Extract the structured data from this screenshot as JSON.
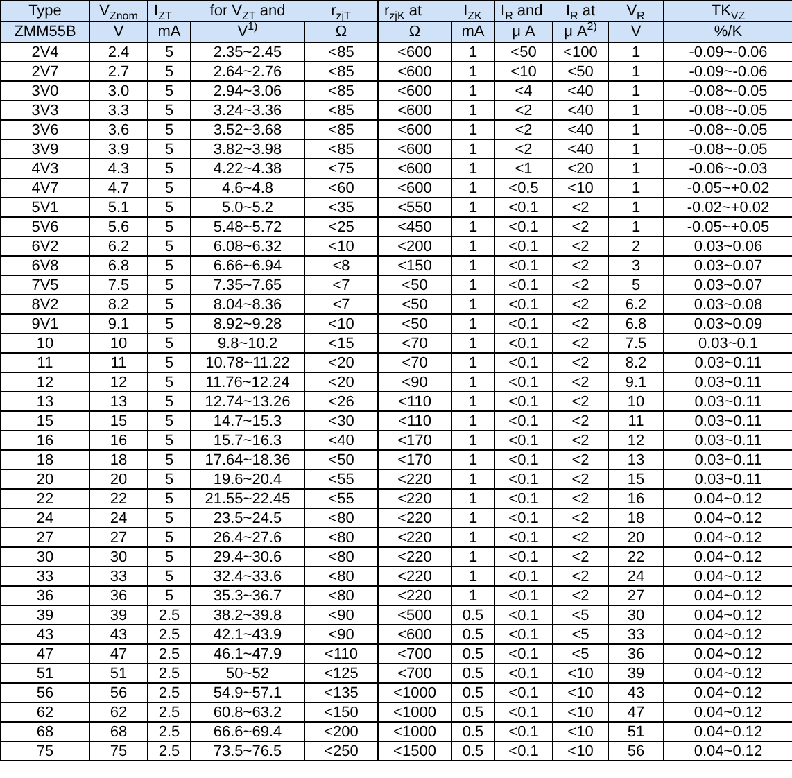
{
  "table": {
    "header_groups": [
      {
        "cells": [
          "Type"
        ]
      },
      {
        "cells": [
          "V$_{Znom}$"
        ]
      },
      {
        "cells": [
          "I$_{ZT}$",
          "for V$_{ZT}$ and",
          "r$_{zjT}$"
        ]
      },
      {
        "cells": [
          "r$_{zjK}$  at",
          "I$_{ZK}$"
        ]
      },
      {
        "cells": [
          "I$_{R}$   and",
          "I$_{R}$   at",
          "V$_{R}$"
        ]
      },
      {
        "cells": [
          "TK$_{VZ}$"
        ]
      }
    ],
    "units": [
      "ZMM55B",
      "V",
      "mA",
      "V$^{1)}$",
      "Ω",
      "Ω",
      "mA",
      "μ A",
      "μ A$^{2)}$",
      "V",
      "%/K"
    ],
    "rows": [
      [
        "2V4",
        "2.4",
        "5",
        "2.35~2.45",
        "<85",
        "<600",
        "1",
        "<50",
        "<100",
        "1",
        "-0.09~-0.06"
      ],
      [
        "2V7",
        "2.7",
        "5",
        "2.64~2.76",
        "<85",
        "<600",
        "1",
        "<10",
        "<50",
        "1",
        "-0.09~-0.06"
      ],
      [
        "3V0",
        "3.0",
        "5",
        "2.94~3.06",
        "<85",
        "<600",
        "1",
        "<4",
        "<40",
        "1",
        "-0.08~-0.05"
      ],
      [
        "3V3",
        "3.3",
        "5",
        "3.24~3.36",
        "<85",
        "<600",
        "1",
        "<2",
        "<40",
        "1",
        "-0.08~-0.05"
      ],
      [
        "3V6",
        "3.6",
        "5",
        "3.52~3.68",
        "<85",
        "<600",
        "1",
        "<2",
        "<40",
        "1",
        "-0.08~-0.05"
      ],
      [
        "3V9",
        "3.9",
        "5",
        "3.82~3.98",
        "<85",
        "<600",
        "1",
        "<2",
        "<40",
        "1",
        "-0.08~-0.05"
      ],
      [
        "4V3",
        "4.3",
        "5",
        "4.22~4.38",
        "<75",
        "<600",
        "1",
        "<1",
        "<20",
        "1",
        "-0.06~-0.03"
      ],
      [
        "4V7",
        "4.7",
        "5",
        "4.6~4.8",
        "<60",
        "<600",
        "1",
        "<0.5",
        "<10",
        "1",
        "-0.05~+0.02"
      ],
      [
        "5V1",
        "5.1",
        "5",
        "5.0~5.2",
        "<35",
        "<550",
        "1",
        "<0.1",
        "<2",
        "1",
        "-0.02~+0.02"
      ],
      [
        "5V6",
        "5.6",
        "5",
        "5.48~5.72",
        "<25",
        "<450",
        "1",
        "<0.1",
        "<2",
        "1",
        "-0.05~+0.05"
      ],
      [
        "6V2",
        "6.2",
        "5",
        "6.08~6.32",
        "<10",
        "<200",
        "1",
        "<0.1",
        "<2",
        "2",
        "0.03~0.06"
      ],
      [
        "6V8",
        "6.8",
        "5",
        "6.66~6.94",
        "<8",
        "<150",
        "1",
        "<0.1",
        "<2",
        "3",
        "0.03~0.07"
      ],
      [
        "7V5",
        "7.5",
        "5",
        "7.35~7.65",
        "<7",
        "<50",
        "1",
        "<0.1",
        "<2",
        "5",
        "0.03~0.07"
      ],
      [
        "8V2",
        "8.2",
        "5",
        "8.04~8.36",
        "<7",
        "<50",
        "1",
        "<0.1",
        "<2",
        "6.2",
        "0.03~0.08"
      ],
      [
        "9V1",
        "9.1",
        "5",
        "8.92~9.28",
        "<10",
        "<50",
        "1",
        "<0.1",
        "<2",
        "6.8",
        "0.03~0.09"
      ],
      [
        "10",
        "10",
        "5",
        "9.8~10.2",
        "<15",
        "<70",
        "1",
        "<0.1",
        "<2",
        "7.5",
        "0.03~0.1"
      ],
      [
        "11",
        "11",
        "5",
        "10.78~11.22",
        "<20",
        "<70",
        "1",
        "<0.1",
        "<2",
        "8.2",
        "0.03~0.11"
      ],
      [
        "12",
        "12",
        "5",
        "11.76~12.24",
        "<20",
        "<90",
        "1",
        "<0.1",
        "<2",
        "9.1",
        "0.03~0.11"
      ],
      [
        "13",
        "13",
        "5",
        "12.74~13.26",
        "<26",
        "<110",
        "1",
        "<0.1",
        "<2",
        "10",
        "0.03~0.11"
      ],
      [
        "15",
        "15",
        "5",
        "14.7~15.3",
        "<30",
        "<110",
        "1",
        "<0.1",
        "<2",
        "11",
        "0.03~0.11"
      ],
      [
        "16",
        "16",
        "5",
        "15.7~16.3",
        "<40",
        "<170",
        "1",
        "<0.1",
        "<2",
        "12",
        "0.03~0.11"
      ],
      [
        "18",
        "18",
        "5",
        "17.64~18.36",
        "<50",
        "<170",
        "1",
        "<0.1",
        "<2",
        "13",
        "0.03~0.11"
      ],
      [
        "20",
        "20",
        "5",
        "19.6~20.4",
        "<55",
        "<220",
        "1",
        "<0.1",
        "<2",
        "15",
        "0.03~0.11"
      ],
      [
        "22",
        "22",
        "5",
        "21.55~22.45",
        "<55",
        "<220",
        "1",
        "<0.1",
        "<2",
        "16",
        "0.04~0.12"
      ],
      [
        "24",
        "24",
        "5",
        "23.5~24.5",
        "<80",
        "<220",
        "1",
        "<0.1",
        "<2",
        "18",
        "0.04~0.12"
      ],
      [
        "27",
        "27",
        "5",
        "26.4~27.6",
        "<80",
        "<220",
        "1",
        "<0.1",
        "<2",
        "20",
        "0.04~0.12"
      ],
      [
        "30",
        "30",
        "5",
        "29.4~30.6",
        "<80",
        "<220",
        "1",
        "<0.1",
        "<2",
        "22",
        "0.04~0.12"
      ],
      [
        "33",
        "33",
        "5",
        "32.4~33.6",
        "<80",
        "<220",
        "1",
        "<0.1",
        "<2",
        "24",
        "0.04~0.12"
      ],
      [
        "36",
        "36",
        "5",
        "35.3~36.7",
        "<80",
        "<220",
        "1",
        "<0.1",
        "<2",
        "27",
        "0.04~0.12"
      ],
      [
        "39",
        "39",
        "2.5",
        "38.2~39.8",
        "<90",
        "<500",
        "0.5",
        "<0.1",
        "<5",
        "30",
        "0.04~0.12"
      ],
      [
        "43",
        "43",
        "2.5",
        "42.1~43.9",
        "<90",
        "<600",
        "0.5",
        "<0.1",
        "<5",
        "33",
        "0.04~0.12"
      ],
      [
        "47",
        "47",
        "2.5",
        "46.1~47.9",
        "<110",
        "<700",
        "0.5",
        "<0.1",
        "<5",
        "36",
        "0.04~0.12"
      ],
      [
        "51",
        "51",
        "2.5",
        "50~52",
        "<125",
        "<700",
        "0.5",
        "<0.1",
        "<10",
        "39",
        "0.04~0.12"
      ],
      [
        "56",
        "56",
        "2.5",
        "54.9~57.1",
        "<135",
        "<1000",
        "0.5",
        "<0.1",
        "<10",
        "43",
        "0.04~0.12"
      ],
      [
        "62",
        "62",
        "2.5",
        "60.8~63.2",
        "<150",
        "<1000",
        "0.5",
        "<0.1",
        "<10",
        "47",
        "0.04~0.12"
      ],
      [
        "68",
        "68",
        "2.5",
        "66.6~69.4",
        "<200",
        "<1000",
        "0.5",
        "<0.1",
        "<10",
        "51",
        "0.04~0.12"
      ],
      [
        "75",
        "75",
        "2.5",
        "73.5~76.5",
        "<250",
        "<1500",
        "0.5",
        "<0.1",
        "<10",
        "56",
        "0.04~0.12"
      ]
    ]
  }
}
